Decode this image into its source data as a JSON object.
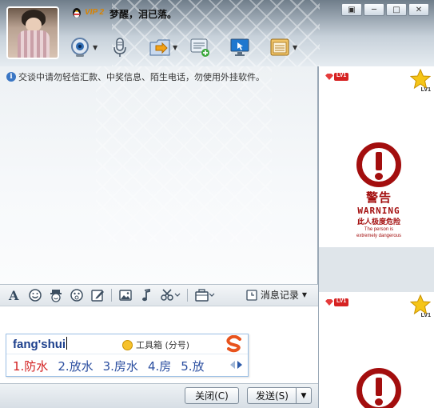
{
  "header": {
    "vip_badge": "VIP 2",
    "contact_name": "梦醒，泪已落。",
    "window_buttons": [
      "▣",
      "─",
      "□",
      "✕"
    ],
    "tools": [
      {
        "name": "video-camera-icon",
        "dropdown": true
      },
      {
        "name": "microphone-icon",
        "dropdown": false
      },
      {
        "name": "send-file-icon",
        "dropdown": true
      },
      {
        "name": "message-plus-icon",
        "dropdown": false
      },
      {
        "name": "remote-desktop-icon",
        "dropdown": false
      },
      {
        "name": "apps-icon",
        "dropdown": true
      }
    ]
  },
  "chat": {
    "notice": "交谈中请勿轻信汇款、中奖信息、陌生电话，勿使用外挂软件。"
  },
  "format_toolbar": {
    "icons": [
      "font-icon",
      "emoji-icon",
      "magic-emoji-icon",
      "screen-shake-icon",
      "handwriting-icon",
      "image-icon",
      "music-icon",
      "screenshot-scissors-icon",
      "toolbox-icon"
    ],
    "history_label": "消息记录"
  },
  "ime": {
    "pinyin": "fang'shui",
    "toolbox_label": "工具箱 (分号)",
    "candidates": [
      "1.防水",
      "2.放水",
      "3.房水",
      "4.房",
      "5.放"
    ]
  },
  "bottom": {
    "close_label": "关闭(C)",
    "send_label": "发送(S)"
  },
  "side": {
    "level_tag": "LV1",
    "star_label": "LV1",
    "warning": {
      "title_cn": "警告",
      "title_en": "WARNING",
      "subtitle_cn": "此人极度危险",
      "line1": "The person is",
      "line2": "extremely dangerous"
    }
  },
  "colors": {
    "warning_red": "#a30e0e",
    "candidate_highlight": "#d21f1f",
    "candidate_text": "#2c4fa0"
  }
}
